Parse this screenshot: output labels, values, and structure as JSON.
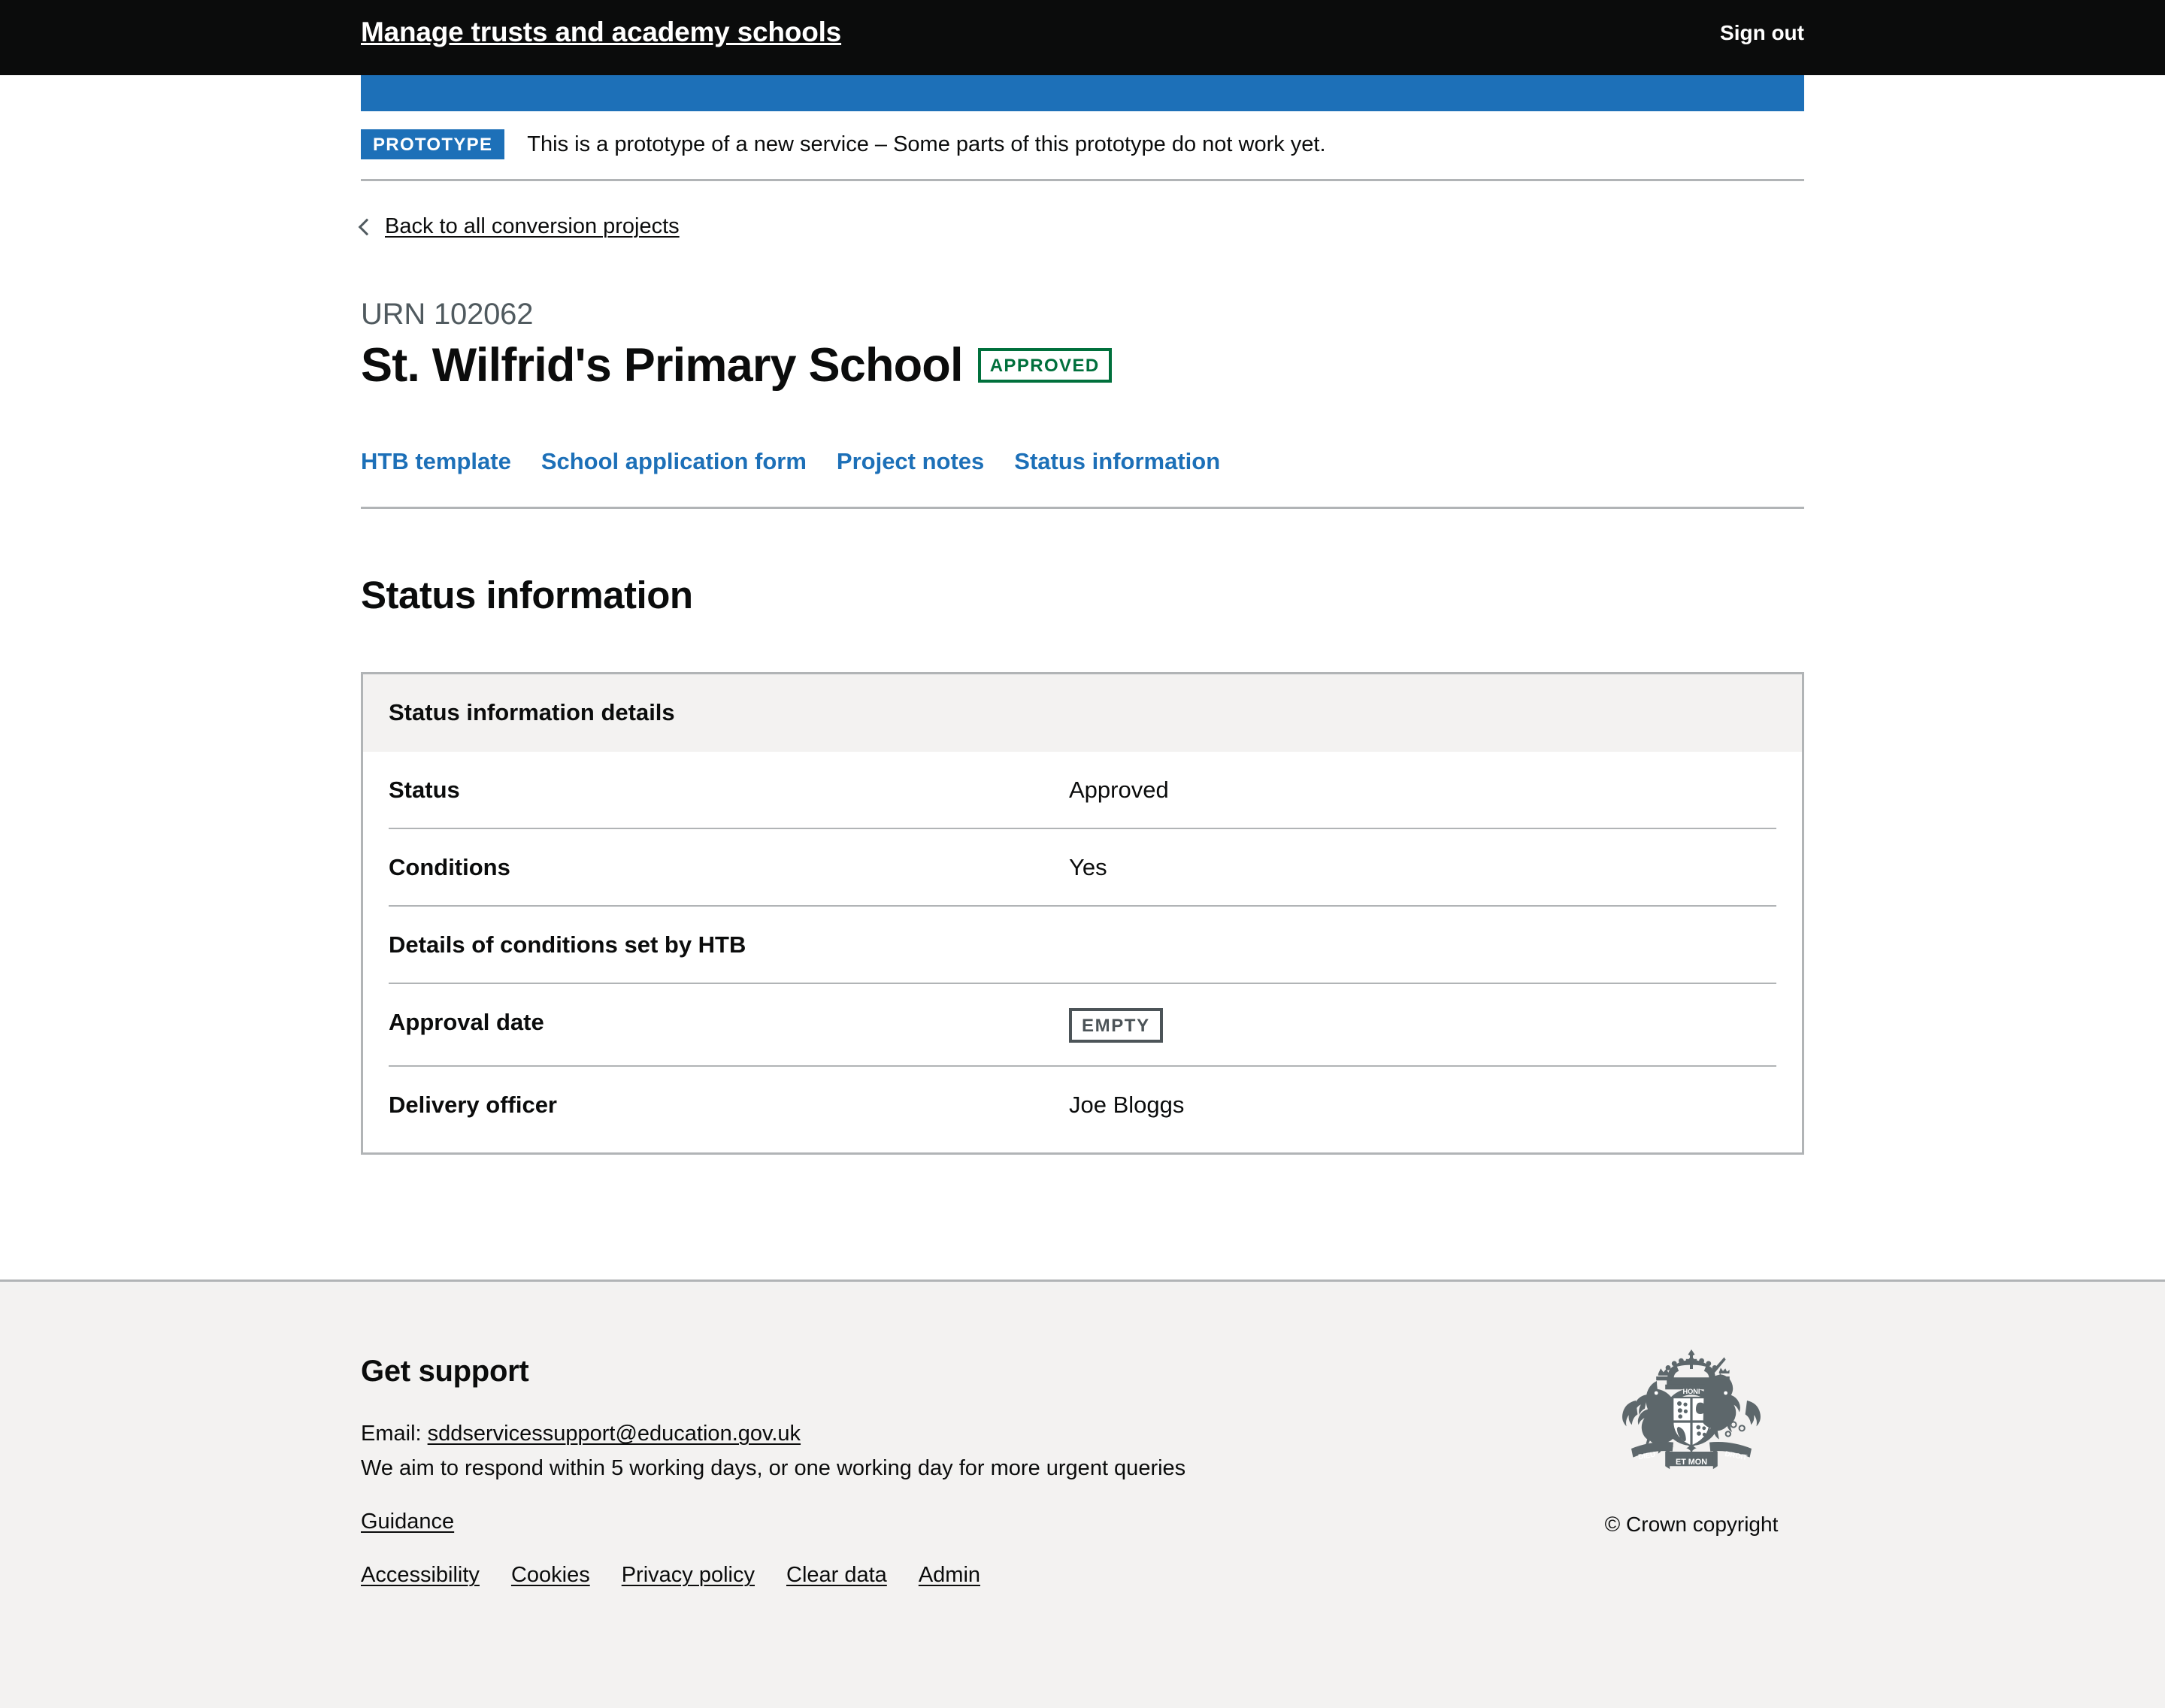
{
  "header": {
    "service_name": "Manage trusts and academy schools",
    "sign_out_label": "Sign out"
  },
  "phase_banner": {
    "tag_label": "PROTOTYPE",
    "text": "This is a prototype of a new service – Some parts of this prototype do not work yet."
  },
  "back_link": {
    "label": "Back to all conversion projects"
  },
  "title": {
    "caption": "URN 102062",
    "heading": "St. Wilfrid's Primary School",
    "status_tag": "APPROVED"
  },
  "subnav": {
    "items": [
      {
        "label": "HTB template"
      },
      {
        "label": "School application form"
      },
      {
        "label": "Project notes"
      },
      {
        "label": "Status information"
      }
    ]
  },
  "main": {
    "section_heading": "Status information",
    "card_title": "Status information details",
    "rows": [
      {
        "key": "Status",
        "value": "Approved",
        "tag": ""
      },
      {
        "key": "Conditions",
        "value": "Yes",
        "tag": ""
      },
      {
        "key": "Details of conditions set by HTB",
        "value": "",
        "tag": ""
      },
      {
        "key": "Approval date",
        "value": "",
        "tag": "EMPTY"
      },
      {
        "key": "Delivery officer",
        "value": "Joe Bloggs",
        "tag": ""
      }
    ]
  },
  "footer": {
    "heading": "Get support",
    "email_prefix": "Email: ",
    "email": "sddservicessupport@education.gov.uk",
    "response_text": "We aim to respond within 5 working days, or one working day for more urgent queries",
    "guidance_label": "Guidance",
    "links": [
      {
        "label": "Accessibility"
      },
      {
        "label": "Cookies"
      },
      {
        "label": "Privacy policy"
      },
      {
        "label": "Clear data"
      },
      {
        "label": "Admin"
      }
    ],
    "crown_caption": "© Crown copyright"
  },
  "colors": {
    "brand_blue": "#1d70b8",
    "header_black": "#0b0c0c",
    "green_tag": "#00703c",
    "grey_tag": "#4c5458",
    "border_grey": "#b1b4b6",
    "footer_bg": "#f3f2f1"
  }
}
